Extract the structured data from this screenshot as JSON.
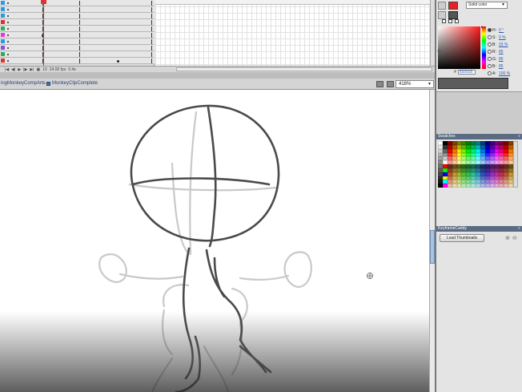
{
  "timeline": {
    "frame_value": "10",
    "fps_value": "24.00 fps",
    "time_value": "0.4s",
    "layer_colors": [
      "#2a9be0",
      "#2a9be0",
      "#2a9be0",
      "#e03030",
      "#2bb052",
      "#e83ad9",
      "#2a9be0",
      "#8a4de0",
      "#2bb052",
      "#e03030"
    ]
  },
  "edit_bar": {
    "scene_crumb": "ingMonkeyCompArts",
    "symbol_crumb": "MonkeyClipComplete",
    "zoom": "418%"
  },
  "color_panel": {
    "fill_type": "Solid color",
    "stroke_color": "#e82020",
    "fill_color": "#555555",
    "hsb": [
      {
        "label": "H:",
        "value": "0 °",
        "selected": true
      },
      {
        "label": "S:",
        "value": "0 %",
        "selected": false
      },
      {
        "label": "B:",
        "value": "33 %",
        "selected": false
      },
      {
        "label": "R:",
        "value": "85",
        "selected": false
      },
      {
        "label": "G:",
        "value": "85",
        "selected": false
      },
      {
        "label": "B:",
        "value": "85",
        "selected": false
      },
      {
        "label": "A:",
        "value": "100 %",
        "selected": false
      }
    ],
    "hex": "555555"
  },
  "swatches": {
    "title": "Swatches"
  },
  "keyframe_caddy": {
    "title": "KeyframeCaddy",
    "load_button": "Load Thumbnails"
  },
  "icons": [
    "pencil-icon",
    "paint-bucket-icon",
    "swap-colors-icon",
    "crosshair-icon",
    "zoom-in-icon",
    "zoom-out-icon",
    "edit-symbol-icon",
    "edit-scene-icon"
  ]
}
